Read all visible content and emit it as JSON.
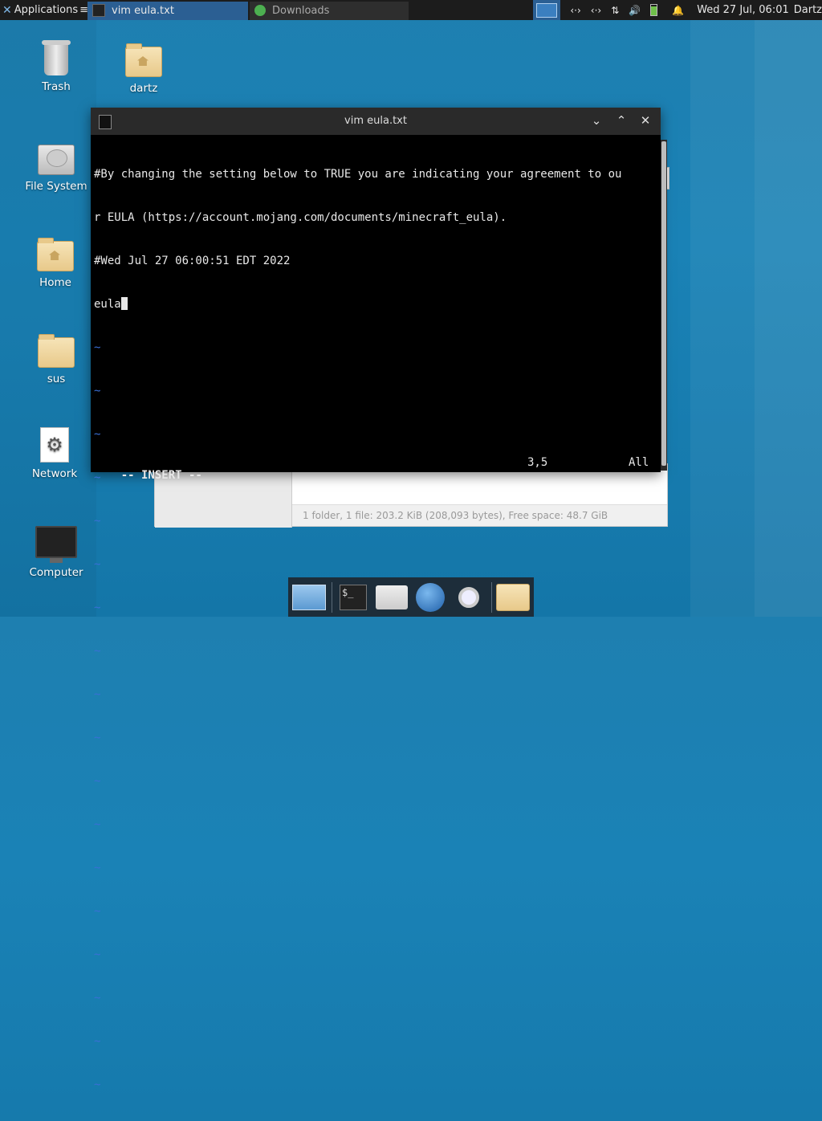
{
  "panel": {
    "applications_label": "Applications",
    "tasks": [
      {
        "label": "vim eula.txt"
      },
      {
        "label": "Downloads"
      }
    ],
    "clock": "Wed 27 Jul, 06:01",
    "user": "Dartz",
    "tray_net1": "‹·›",
    "tray_net2": "‹·›",
    "tray_updown": "⇅",
    "tray_volume": "🔊",
    "tray_bell": "🔔"
  },
  "desktop_icons": [
    {
      "label": "Trash"
    },
    {
      "label": "dartz"
    },
    {
      "label": "File System"
    },
    {
      "label": "Home"
    },
    {
      "label": "sus"
    },
    {
      "label": "Network"
    },
    {
      "label": "Computer"
    }
  ],
  "file_manager": {
    "status_text": "1 folder, 1 file: 203.2 KiB (208,093 bytes), Free space: 48.7 GiB"
  },
  "terminal": {
    "title": "vim eula.txt",
    "lines": [
      "#By changing the setting below to TRUE you are indicating your agreement to ou",
      "r EULA (https://account.mojang.com/documents/minecraft_eula).",
      "#Wed Jul 27 06:00:51 EDT 2022",
      "eula"
    ],
    "tilde": "~",
    "mode": "-- INSERT --",
    "position": "3,5",
    "percent": "All"
  },
  "dock": {
    "terminal_glyph": "$_"
  },
  "colors": {
    "panel_bg": "#1c1c1c",
    "active_task": "#2b5f93",
    "desktop": "#1a82b6",
    "tilde": "#3a6fd6"
  }
}
